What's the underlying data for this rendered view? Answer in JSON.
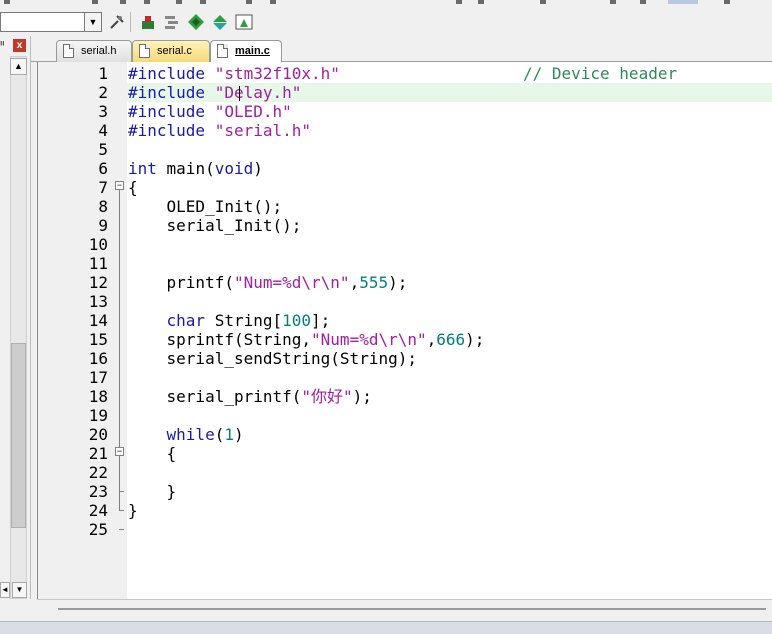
{
  "toolbar": {
    "target_value": "",
    "icons": [
      "combo-dropdown-icon",
      "build-options-icon",
      "manage-project-items-icon",
      "select-packs-icon",
      "pack-installer-icon",
      "run-time-environment-icon"
    ]
  },
  "left_pane": {
    "pin_glyph": "ᐦ",
    "close_glyph": "x",
    "scroll_up_glyph": "▲",
    "scroll_left_glyph": "◄",
    "scroll_down_glyph": "▼"
  },
  "tabs": [
    {
      "label": "serial.h",
      "active": false
    },
    {
      "label": "serial.c",
      "active": false,
      "modified": true
    },
    {
      "label": "main.c",
      "active": true
    }
  ],
  "editor": {
    "current_line": 2,
    "lines": [
      {
        "n": "1",
        "text": "#include \"stm32f10x.h\"                   // Device header"
      },
      {
        "n": "2",
        "text": "#include \"Delay.h\""
      },
      {
        "n": "3",
        "text": "#include \"OLED.h\""
      },
      {
        "n": "4",
        "text": "#include \"serial.h\""
      },
      {
        "n": "5",
        "text": ""
      },
      {
        "n": "6",
        "text": "int main(void)"
      },
      {
        "n": "7",
        "text": "{"
      },
      {
        "n": "8",
        "text": "    OLED_Init();"
      },
      {
        "n": "9",
        "text": "    serial_Init();"
      },
      {
        "n": "10",
        "text": ""
      },
      {
        "n": "11",
        "text": ""
      },
      {
        "n": "12",
        "text": "    printf(\"Num=%d\\r\\n\",555);"
      },
      {
        "n": "13",
        "text": ""
      },
      {
        "n": "14",
        "text": "    char String[100];"
      },
      {
        "n": "15",
        "text": "    sprintf(String,\"Num=%d\\r\\n\",666);"
      },
      {
        "n": "16",
        "text": "    serial_sendString(String);"
      },
      {
        "n": "17",
        "text": ""
      },
      {
        "n": "18",
        "text": "    serial_printf(\"你好\");"
      },
      {
        "n": "19",
        "text": ""
      },
      {
        "n": "20",
        "text": "    while(1)"
      },
      {
        "n": "21",
        "text": "    {"
      },
      {
        "n": "22",
        "text": ""
      },
      {
        "n": "23",
        "text": "    }"
      },
      {
        "n": "24",
        "text": "}"
      },
      {
        "n": "25",
        "text": ""
      }
    ]
  },
  "syntax_colors": {
    "keyword": "#1a1aa6",
    "string": "#a020a0",
    "number": "#008080",
    "comment": "#2e8b57",
    "current_line_bg": "#e8f8e8"
  }
}
